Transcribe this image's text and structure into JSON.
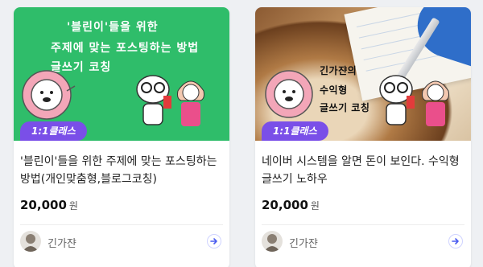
{
  "colors": {
    "page_bg": "#eef0f3",
    "card_bg": "#ffffff",
    "badge_purple": "#7a4fe8",
    "thumb_green": "#2fbd6a",
    "arrow_blue": "#4a5cf0"
  },
  "cards": [
    {
      "thumbnail": {
        "lines": [
          "'블린이'들을 위한",
          "주제에 맞는 포스팅하는 방법",
          "글쓰기 코칭"
        ]
      },
      "badge": "1:1클래스",
      "title": "'블린이'들을 위한 주제에 맞는 포스팅하는 방법(개인맞춤형,블로그코칭)",
      "price": "20,000",
      "price_unit": "원",
      "author": "긴가쟌",
      "icons": [
        "lion-mascot-icon",
        "cat-mascot-icon",
        "girl-character-icon",
        "avatar-icon",
        "arrow-right-icon"
      ]
    },
    {
      "thumbnail": {
        "lines": [
          "긴가쟌의",
          "수익형",
          "글쓰기 코칭"
        ]
      },
      "badge": "1:1클래스",
      "title": "네이버 시스템을 알면 돈이 보인다. 수익형 글쓰기 노하우",
      "price": "20,000",
      "price_unit": "원",
      "author": "긴가쟌",
      "icons": [
        "lion-mascot-icon",
        "cat-mascot-icon",
        "girl-character-icon",
        "avatar-icon",
        "arrow-right-icon"
      ]
    }
  ]
}
